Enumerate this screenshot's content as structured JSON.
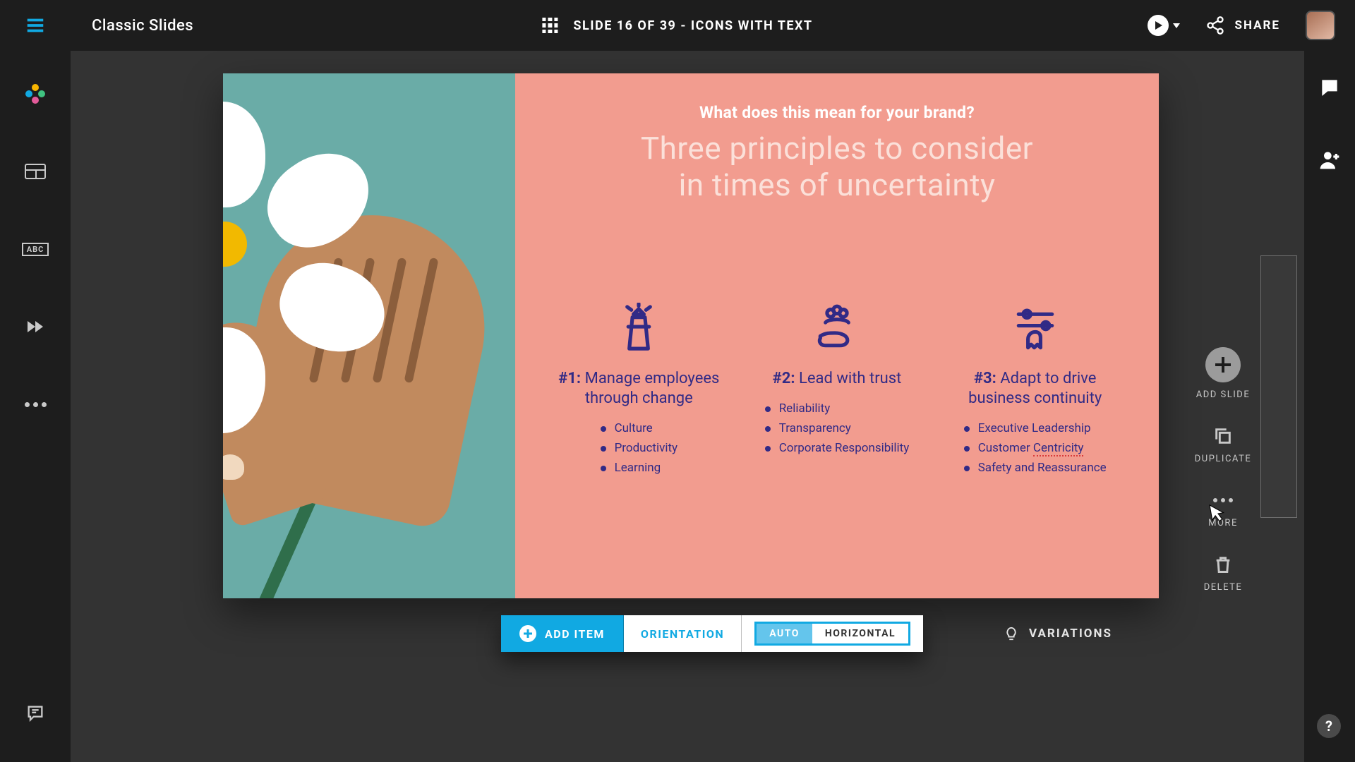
{
  "topbar": {
    "title": "Classic Slides",
    "slide_info": "SLIDE 16 OF 39 - ICONS WITH TEXT",
    "share_label": "SHARE"
  },
  "leftrail": {
    "abc_label": "ABC"
  },
  "slide": {
    "eyebrow": "What does this mean for your brand?",
    "headline_line1": "Three principles to consider",
    "headline_line2": "in times of uncertainty",
    "columns": [
      {
        "tag": "#1:",
        "title_line1": "Manage employees",
        "title_line2": "through change",
        "bullets": [
          "Culture",
          "Productivity",
          "Learning"
        ]
      },
      {
        "tag": "#2:",
        "title_line1": "Lead with trust",
        "title_line2": "",
        "bullets": [
          "Reliability",
          "Transparency",
          "Corporate Responsibility"
        ]
      },
      {
        "tag": "#3:",
        "title_line1": "Adapt to drive",
        "title_line2": "business continuity",
        "bullets": [
          "Executive Leadership",
          "Customer Centricity",
          "Safety and Reassurance"
        ],
        "misspelled_word": "Centricity"
      }
    ]
  },
  "actions": {
    "add_slide": "ADD SLIDE",
    "duplicate": "DUPLICATE",
    "more": "MORE",
    "delete": "DELETE"
  },
  "bottombar": {
    "add_item": "ADD ITEM",
    "orientation": "ORIENTATION",
    "auto": "AUTO",
    "horizontal": "HORIZONTAL"
  },
  "variations_label": "VARIATIONS",
  "help_label": "?"
}
